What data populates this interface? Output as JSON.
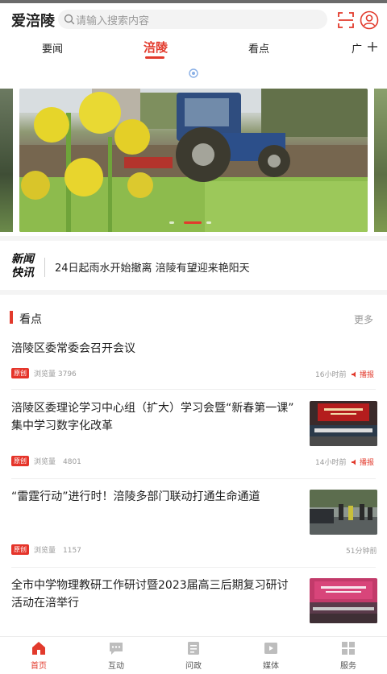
{
  "header": {
    "logo": "爱涪陵",
    "search_placeholder": "请输入搜索内容"
  },
  "tabs": [
    {
      "label": "要闻",
      "active": false
    },
    {
      "label": "涪陵",
      "active": true
    },
    {
      "label": "看点",
      "active": false
    },
    {
      "label": "广",
      "active": false
    }
  ],
  "banner": {
    "slides": 3
  },
  "flash": {
    "logo_line1": "新闻",
    "logo_line2": "快讯",
    "text": "24日起雨水开始撤离 涪陵有望迎来艳阳天"
  },
  "section": {
    "title": "看点",
    "more": "更多"
  },
  "articles": [
    {
      "title": "涪陵区委常委会召开会议",
      "badge": "原创",
      "views": "浏览量 3796",
      "time": "16小时前",
      "play": "播报"
    },
    {
      "title_line1": "涪陵区委理论学习中心组（扩大）学习会暨“新春第一课”",
      "title_line2": "集中学习数字化改革",
      "badge": "原创",
      "views": "浏览量　4801",
      "time": "14小时前",
      "play": "播报"
    },
    {
      "title": "“雷霆行动”进行时！涪陵多部门联动打通生命通道",
      "badge": "原创",
      "views": "浏览量　1157",
      "time": "51分钟前"
    },
    {
      "title_line1": "全市中学物理教研工作研讨暨2023届高三后期复习研讨",
      "title_line2": "活动在涪举行"
    }
  ],
  "bottom_nav": [
    {
      "label": "首页",
      "icon": "home-icon",
      "active": true
    },
    {
      "label": "互动",
      "icon": "chat-icon",
      "active": false
    },
    {
      "label": "问政",
      "icon": "ask-icon",
      "active": false
    },
    {
      "label": "媒体",
      "icon": "media-icon",
      "active": false
    },
    {
      "label": "服务",
      "icon": "service-icon",
      "active": false
    }
  ],
  "colors": {
    "accent": "#e23a2c",
    "muted_text": "#9a9a9a",
    "background": "#ffffff"
  }
}
